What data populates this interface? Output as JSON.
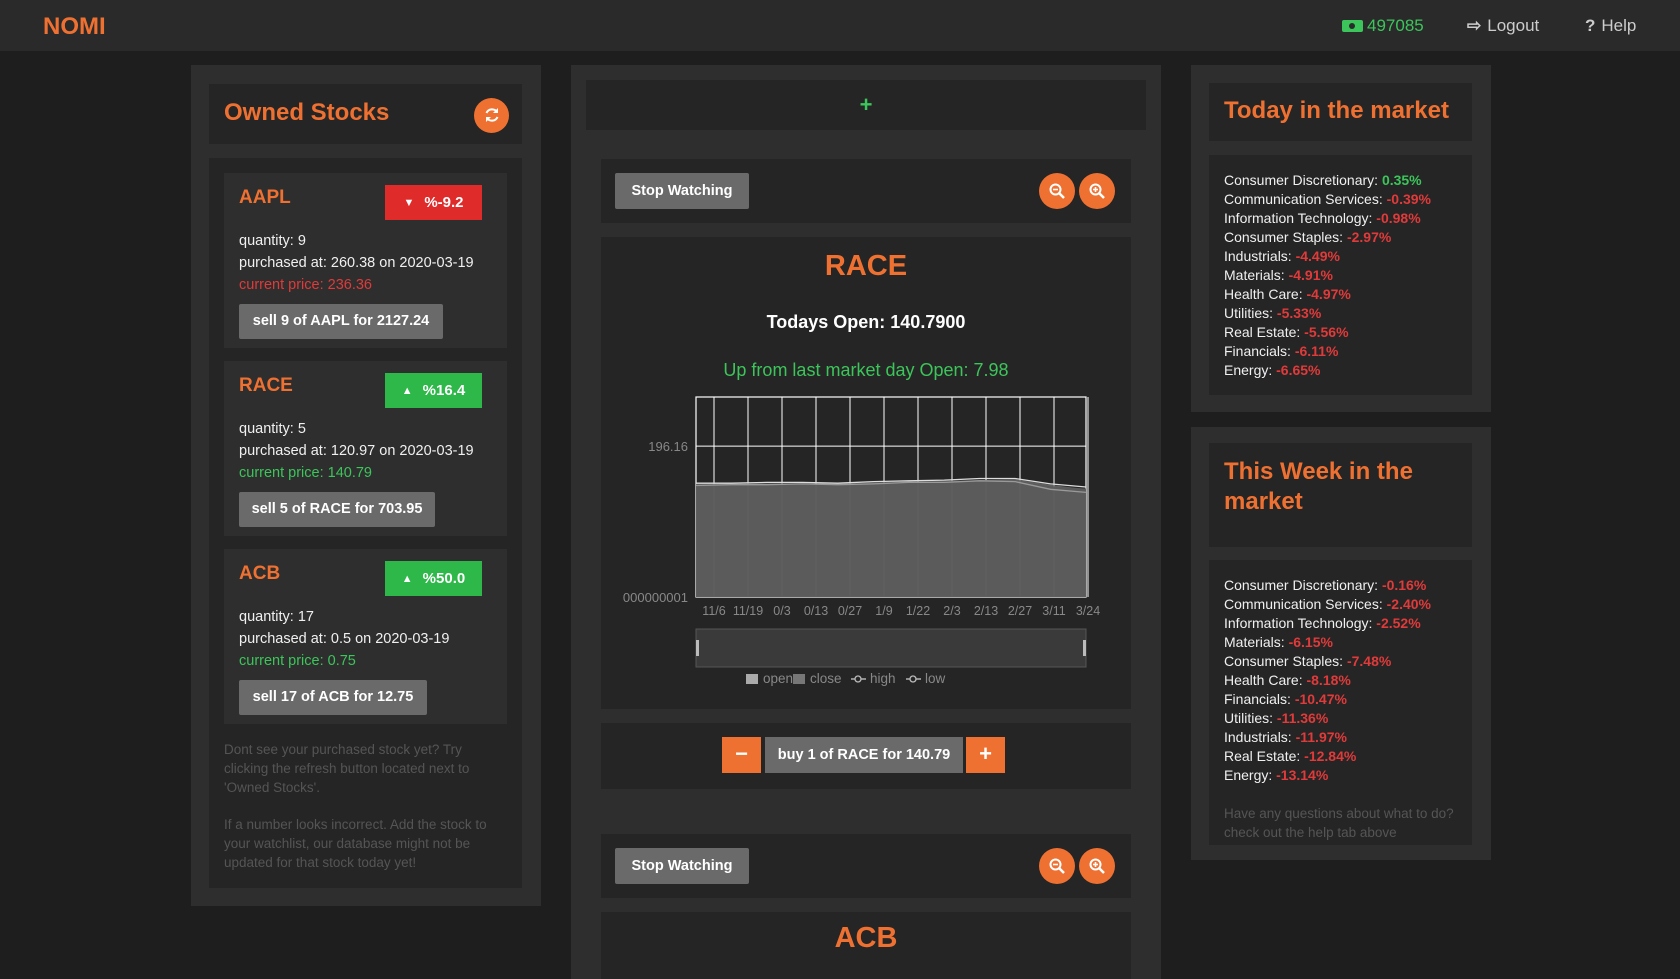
{
  "app": {
    "brand": "NOMI",
    "balance": "497085",
    "logout_label": "Logout",
    "help_label": "Help",
    "accent_color": "#ef7132"
  },
  "owned": {
    "title": "Owned Stocks",
    "stocks": [
      {
        "symbol": "AAPL",
        "change": "%-9.2",
        "direction": "down",
        "quantity": "quantity: 9",
        "purchased": "purchased at: 260.38 on 2020-03-19",
        "current": "current price: 236.36",
        "sell_label": "sell 9 of AAPL for 2127.24"
      },
      {
        "symbol": "RACE",
        "change": "%16.4",
        "direction": "up",
        "quantity": "quantity: 5",
        "purchased": "purchased at: 120.97 on 2020-03-19",
        "current": "current price: 140.79",
        "sell_label": "sell 5 of RACE for 703.95"
      },
      {
        "symbol": "ACB",
        "change": "%50.0",
        "direction": "up",
        "quantity": "quantity: 17",
        "purchased": "purchased at: 0.5 on 2020-03-19",
        "current": "current price: 0.75",
        "sell_label": "sell 17 of ACB for 12.75"
      }
    ],
    "hint1": "Dont see your purchased stock yet? Try clicking the refresh button located next to 'Owned Stocks'.",
    "hint2": "If a number looks incorrect. Add the stock to your watchlist, our database might not be updated for that stock today yet!"
  },
  "watch": {
    "add_label": "+",
    "stop_label": "Stop Watching",
    "items": [
      {
        "symbol": "RACE",
        "todays_open": "Todays Open: 140.7900",
        "delta": "Up from last market day Open: 7.98",
        "buy_label": "buy 1 of RACE for 140.79"
      },
      {
        "symbol": "ACB"
      }
    ]
  },
  "chart_data": {
    "type": "area",
    "title": "",
    "xlabel": "",
    "ylabel": "",
    "y_tick_labels": [
      "196.16",
      "000000001"
    ],
    "categories": [
      "11/6",
      "11/19",
      "0/3",
      "0/13",
      "0/27",
      "1/9",
      "1/22",
      "2/3",
      "2/13",
      "2/27",
      "3/11",
      "3/24"
    ],
    "legend_position": "bottom",
    "series": [
      {
        "name": "open",
        "values": [
          146,
          147,
          147,
          148,
          147,
          148,
          150,
          150,
          152,
          153,
          146,
          140
        ]
      },
      {
        "name": "close",
        "values": [
          147,
          147,
          148,
          148,
          147,
          149,
          150,
          151,
          152,
          151,
          144,
          141
        ]
      },
      {
        "name": "high",
        "values": [
          148,
          148,
          149,
          149,
          148,
          150,
          151,
          152,
          154,
          154,
          147,
          143
        ]
      },
      {
        "name": "low",
        "values": [
          145,
          146,
          146,
          147,
          146,
          147,
          149,
          149,
          151,
          150,
          140,
          136
        ]
      }
    ],
    "ylim": [
      0,
      260
    ],
    "grid": true
  },
  "today_market": {
    "title": "Today in the market",
    "sectors": [
      {
        "name": "Consumer Discretionary: ",
        "value": "0.35%",
        "sign": "pos"
      },
      {
        "name": "Communication Services: ",
        "value": "-0.39%",
        "sign": "neg"
      },
      {
        "name": "Information Technology: ",
        "value": "-0.98%",
        "sign": "neg"
      },
      {
        "name": "Consumer Staples: ",
        "value": "-2.97%",
        "sign": "neg"
      },
      {
        "name": "Industrials: ",
        "value": "-4.49%",
        "sign": "neg"
      },
      {
        "name": "Materials: ",
        "value": "-4.91%",
        "sign": "neg"
      },
      {
        "name": "Health Care: ",
        "value": "-4.97%",
        "sign": "neg"
      },
      {
        "name": "Utilities: ",
        "value": "-5.33%",
        "sign": "neg"
      },
      {
        "name": "Real Estate: ",
        "value": "-5.56%",
        "sign": "neg"
      },
      {
        "name": "Financials: ",
        "value": "-6.11%",
        "sign": "neg"
      },
      {
        "name": "Energy: ",
        "value": "-6.65%",
        "sign": "neg"
      }
    ]
  },
  "week_market": {
    "title": "This Week in the market",
    "sectors": [
      {
        "name": "Consumer Discretionary: ",
        "value": "-0.16%",
        "sign": "neg"
      },
      {
        "name": "Communication Services: ",
        "value": "-2.40%",
        "sign": "neg"
      },
      {
        "name": "Information Technology: ",
        "value": "-2.52%",
        "sign": "neg"
      },
      {
        "name": "Materials: ",
        "value": "-6.15%",
        "sign": "neg"
      },
      {
        "name": "Consumer Staples: ",
        "value": "-7.48%",
        "sign": "neg"
      },
      {
        "name": "Health Care: ",
        "value": "-8.18%",
        "sign": "neg"
      },
      {
        "name": "Financials: ",
        "value": "-10.47%",
        "sign": "neg"
      },
      {
        "name": "Utilities: ",
        "value": "-11.36%",
        "sign": "neg"
      },
      {
        "name": "Industrials: ",
        "value": "-11.97%",
        "sign": "neg"
      },
      {
        "name": "Real Estate: ",
        "value": "-12.84%",
        "sign": "neg"
      },
      {
        "name": "Energy: ",
        "value": "-13.14%",
        "sign": "neg"
      }
    ],
    "hint": "Have any questions about what to do? check out the help tab above"
  }
}
